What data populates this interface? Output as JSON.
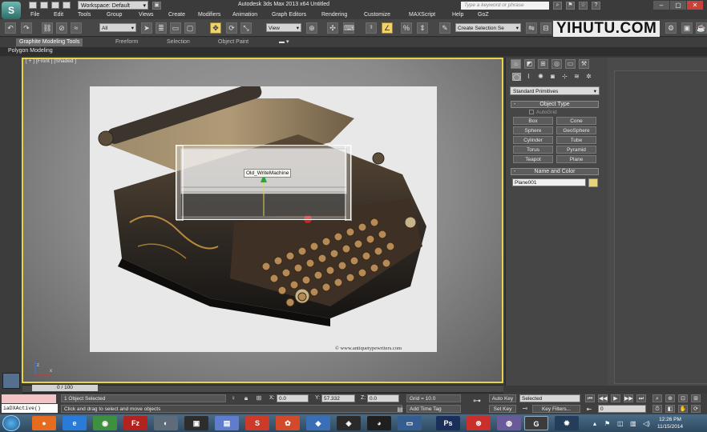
{
  "app": {
    "logo": "S",
    "window_title": "Autodesk 3ds Max  2013 x64    Untitled",
    "workspace": "Workspace: Default",
    "search_placeholder": "Type a keyword or phrase",
    "watermark": "YIHUTU.COM"
  },
  "menu": [
    "File",
    "Edit",
    "Tools",
    "Group",
    "Views",
    "Create",
    "Modifiers",
    "Animation",
    "Graph Editors",
    "Rendering",
    "Customize",
    "MAXScript",
    "Help",
    "GoZ"
  ],
  "toolbar": {
    "selection_filter": "All",
    "ref_coord": "View",
    "named_selection": "Create Selection Se"
  },
  "ribbon": {
    "tabs": [
      "Graphite Modeling Tools",
      "Freeform",
      "Selection",
      "Object Paint"
    ],
    "active_tab": "Graphite Modeling Tools",
    "sub_label": "Polygon Modeling"
  },
  "viewport": {
    "label": "[ + ] [Front ] [Shaded ]",
    "object_tag": "Old_WriteMachine",
    "photo_caption": "© www.antiquetypewriters.com"
  },
  "timeslider": {
    "position": "0 / 100"
  },
  "command_panel": {
    "category": "Standard Primitives",
    "object_type_header": "Object Type",
    "autogrid_label": "AutoGrid",
    "buttons": [
      "Box",
      "Cone",
      "Sphere",
      "GeoSphere",
      "Cylinder",
      "Tube",
      "Torus",
      "Pyramid",
      "Teapot",
      "Plane"
    ],
    "name_color_header": "Name and Color",
    "object_name": "Plane001"
  },
  "status": {
    "listener_cmd": "iaDXActive()",
    "selection": "1 Object Selected",
    "prompt": "Click and drag to select and move objects",
    "x": "0.0",
    "y": "57.332",
    "z": "0.0",
    "grid": "Grid = 10.0",
    "add_time_tag": "Add Time Tag",
    "auto_key": "Auto Key",
    "auto_key_mode": "Selected",
    "set_key": "Set Key",
    "key_filters": "Key Filters...",
    "frame": "0"
  },
  "taskbar": {
    "time": "12:26 PM",
    "date": "11/15/2014"
  },
  "colors": {
    "viewport_border": "#e8d24a",
    "active_tool": "#f1d36b",
    "taskbar": "#2d4960"
  }
}
